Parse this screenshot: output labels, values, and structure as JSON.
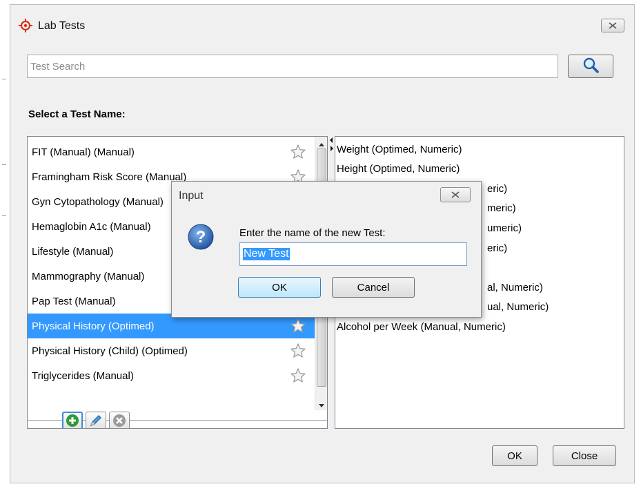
{
  "window": {
    "title": "Lab Tests",
    "search_placeholder": "Test Search",
    "section_label": "Select a Test Name:",
    "ok_label": "OK",
    "close_label": "Close"
  },
  "tests": [
    {
      "label": "FIT (Manual) (Manual)",
      "selected": false
    },
    {
      "label": "Framingham Risk Score (Manual)",
      "selected": false
    },
    {
      "label": "Gyn Cytopathology (Manual)",
      "selected": false
    },
    {
      "label": "Hemaglobin A1c (Manual)",
      "selected": false
    },
    {
      "label": "Lifestyle (Manual)",
      "selected": false
    },
    {
      "label": "Mammography (Manual)",
      "selected": false
    },
    {
      "label": "Pap Test (Manual)",
      "selected": false
    },
    {
      "label": "Physical History (Optimed)",
      "selected": true
    },
    {
      "label": "Physical History (Child) (Optimed)",
      "selected": false
    },
    {
      "label": "Triglycerides (Manual)",
      "selected": false
    }
  ],
  "fields": [
    "Weight (Optimed, Numeric)",
    "Height (Optimed, Numeric)",
    "",
    "",
    "",
    "",
    "",
    "",
    "",
    "Alcohol per Week (Manual, Numeric)"
  ],
  "fields_partial": [
    {
      "index": 2,
      "label": "eric)"
    },
    {
      "index": 3,
      "label": "meric)"
    },
    {
      "index": 4,
      "label": "umeric)"
    },
    {
      "index": 5,
      "label": "eric)"
    },
    {
      "index": 7,
      "label": "al, Numeric)"
    },
    {
      "index": 8,
      "label": "ual, Numeric)"
    }
  ],
  "dialog": {
    "title": "Input",
    "prompt": "Enter the name of the new Test:",
    "value": "New Test",
    "ok_label": "OK",
    "cancel_label": "Cancel"
  },
  "colors": {
    "selection": "#3399ff",
    "accent_red": "#d7331e",
    "add_green": "#2f9a3c",
    "question_blue": "#2d63b4"
  },
  "icons": [
    "target-icon",
    "close-icon",
    "search-icon",
    "star-icon",
    "add-icon",
    "edit-icon",
    "remove-icon",
    "question-icon"
  ]
}
